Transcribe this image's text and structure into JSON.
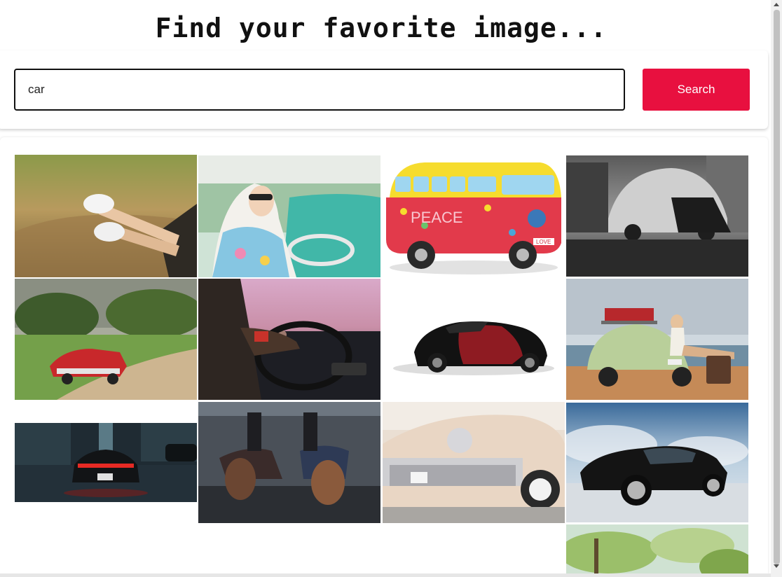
{
  "header": {
    "title": "Find your favorite image..."
  },
  "search": {
    "value": "car",
    "placeholder": "",
    "button_label": "Search"
  },
  "results": [
    {
      "name": "sneakers-out-car-window-photo"
    },
    {
      "name": "woman-headscarf-driving-vintage-car-photo"
    },
    {
      "name": "peace-flower-van-photo",
      "badge": "PEACE",
      "plate": "LOVE"
    },
    {
      "name": "black-white-beetle-couple-photo"
    },
    {
      "name": "red-vintage-convertible-road-photo"
    },
    {
      "name": "man-driving-sunset-photo"
    },
    {
      "name": "black-red-supercar-photo"
    },
    {
      "name": "woman-green-beetle-beach-photo"
    },
    {
      "name": "red-taillights-rainy-street-photo"
    },
    {
      "name": "couple-lying-on-car-hood-photo"
    },
    {
      "name": "cream-vintage-cadillac-photo"
    },
    {
      "name": "black-mustang-hdr-photo"
    },
    {
      "name": "trees-partial-photo"
    }
  ],
  "colors": {
    "accent": "#e8103f",
    "text": "#111111"
  }
}
